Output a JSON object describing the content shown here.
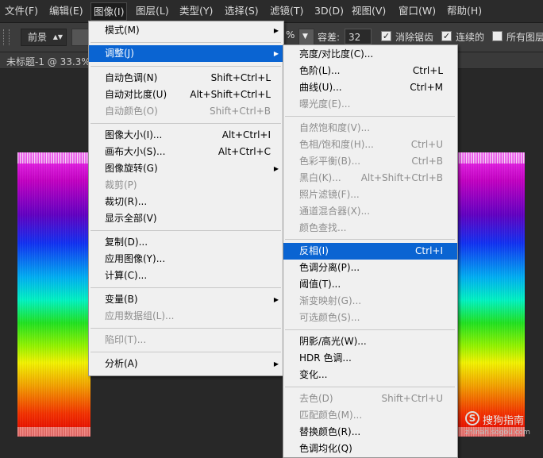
{
  "menubar": {
    "items": [
      "文件(F)",
      "编辑(E)",
      "图像(I)",
      "图层(L)",
      "类型(Y)",
      "选择(S)",
      "滤镜(T)",
      "3D(D)",
      "视图(V)",
      "窗口(W)",
      "帮助(H)"
    ],
    "active_index": 2
  },
  "options": {
    "mode_select": "前景",
    "percent_label": "%",
    "tolerance_label": "容差:",
    "tolerance_value": "32",
    "antialias_label": "消除锯齿",
    "antialias_checked": true,
    "contiguous_label": "连续的",
    "contiguous_checked": true,
    "all_layers_label": "所有图层",
    "all_layers_checked": false
  },
  "document": {
    "tab_label": "未标题-1 @ 33.3%"
  },
  "image_menu": {
    "items": [
      {
        "label": "模式(M)",
        "shortcut": "",
        "submenu": true,
        "disabled": false,
        "highlighted": false
      },
      {
        "label": "调整(J)",
        "shortcut": "",
        "submenu": true,
        "disabled": false,
        "highlighted": true
      },
      {
        "label": "自动色调(N)",
        "shortcut": "Shift+Ctrl+L",
        "submenu": false,
        "disabled": false,
        "highlighted": false
      },
      {
        "label": "自动对比度(U)",
        "shortcut": "Alt+Shift+Ctrl+L",
        "submenu": false,
        "disabled": false,
        "highlighted": false
      },
      {
        "label": "自动颜色(O)",
        "shortcut": "Shift+Ctrl+B",
        "submenu": false,
        "disabled": true,
        "highlighted": false
      },
      {
        "label": "图像大小(I)...",
        "shortcut": "Alt+Ctrl+I",
        "submenu": false,
        "disabled": false,
        "highlighted": false
      },
      {
        "label": "画布大小(S)...",
        "shortcut": "Alt+Ctrl+C",
        "submenu": false,
        "disabled": false,
        "highlighted": false
      },
      {
        "label": "图像旋转(G)",
        "shortcut": "",
        "submenu": true,
        "disabled": false,
        "highlighted": false
      },
      {
        "label": "裁剪(P)",
        "shortcut": "",
        "submenu": false,
        "disabled": true,
        "highlighted": false
      },
      {
        "label": "裁切(R)...",
        "shortcut": "",
        "submenu": false,
        "disabled": false,
        "highlighted": false
      },
      {
        "label": "显示全部(V)",
        "shortcut": "",
        "submenu": false,
        "disabled": false,
        "highlighted": false
      },
      {
        "label": "复制(D)...",
        "shortcut": "",
        "submenu": false,
        "disabled": false,
        "highlighted": false
      },
      {
        "label": "应用图像(Y)...",
        "shortcut": "",
        "submenu": false,
        "disabled": false,
        "highlighted": false
      },
      {
        "label": "计算(C)...",
        "shortcut": "",
        "submenu": false,
        "disabled": false,
        "highlighted": false
      },
      {
        "label": "变量(B)",
        "shortcut": "",
        "submenu": true,
        "disabled": false,
        "highlighted": false
      },
      {
        "label": "应用数据组(L)...",
        "shortcut": "",
        "submenu": false,
        "disabled": true,
        "highlighted": false
      },
      {
        "label": "陷印(T)...",
        "shortcut": "",
        "submenu": false,
        "disabled": true,
        "highlighted": false
      },
      {
        "label": "分析(A)",
        "shortcut": "",
        "submenu": true,
        "disabled": false,
        "highlighted": false
      }
    ]
  },
  "adjust_menu": {
    "items": [
      {
        "label": "亮度/对比度(C)...",
        "shortcut": "",
        "disabled": false,
        "highlighted": false
      },
      {
        "label": "色阶(L)...",
        "shortcut": "Ctrl+L",
        "disabled": false,
        "highlighted": false
      },
      {
        "label": "曲线(U)...",
        "shortcut": "Ctrl+M",
        "disabled": false,
        "highlighted": false
      },
      {
        "label": "曝光度(E)...",
        "shortcut": "",
        "disabled": true,
        "highlighted": false
      },
      {
        "label": "自然饱和度(V)...",
        "shortcut": "",
        "disabled": true,
        "highlighted": false
      },
      {
        "label": "色相/饱和度(H)...",
        "shortcut": "Ctrl+U",
        "disabled": true,
        "highlighted": false
      },
      {
        "label": "色彩平衡(B)...",
        "shortcut": "Ctrl+B",
        "disabled": true,
        "highlighted": false
      },
      {
        "label": "黑白(K)...",
        "shortcut": "Alt+Shift+Ctrl+B",
        "disabled": true,
        "highlighted": false
      },
      {
        "label": "照片滤镜(F)...",
        "shortcut": "",
        "disabled": true,
        "highlighted": false
      },
      {
        "label": "通道混合器(X)...",
        "shortcut": "",
        "disabled": true,
        "highlighted": false
      },
      {
        "label": "颜色查找...",
        "shortcut": "",
        "disabled": true,
        "highlighted": false
      },
      {
        "label": "反相(I)",
        "shortcut": "Ctrl+I",
        "disabled": false,
        "highlighted": true
      },
      {
        "label": "色调分离(P)...",
        "shortcut": "",
        "disabled": false,
        "highlighted": false
      },
      {
        "label": "阈值(T)...",
        "shortcut": "",
        "disabled": false,
        "highlighted": false
      },
      {
        "label": "渐变映射(G)...",
        "shortcut": "",
        "disabled": true,
        "highlighted": false
      },
      {
        "label": "可选颜色(S)...",
        "shortcut": "",
        "disabled": true,
        "highlighted": false
      },
      {
        "label": "阴影/高光(W)...",
        "shortcut": "",
        "disabled": false,
        "highlighted": false
      },
      {
        "label": "HDR 色调...",
        "shortcut": "",
        "disabled": false,
        "highlighted": false
      },
      {
        "label": "变化...",
        "shortcut": "",
        "disabled": false,
        "highlighted": false
      },
      {
        "label": "去色(D)",
        "shortcut": "Shift+Ctrl+U",
        "disabled": true,
        "highlighted": false
      },
      {
        "label": "匹配颜色(M)...",
        "shortcut": "",
        "disabled": true,
        "highlighted": false
      },
      {
        "label": "替换颜色(R)...",
        "shortcut": "",
        "disabled": false,
        "highlighted": false
      },
      {
        "label": "色调均化(Q)",
        "shortcut": "",
        "disabled": false,
        "highlighted": false
      }
    ]
  },
  "watermark": {
    "logo_glyph": "S",
    "text": "搜狗指南",
    "sub": "zhinan.sogou.com"
  },
  "colors": {
    "highlight": "#0a64d2",
    "menu_bg": "#f0f0f0",
    "app_bg": "#282828"
  }
}
